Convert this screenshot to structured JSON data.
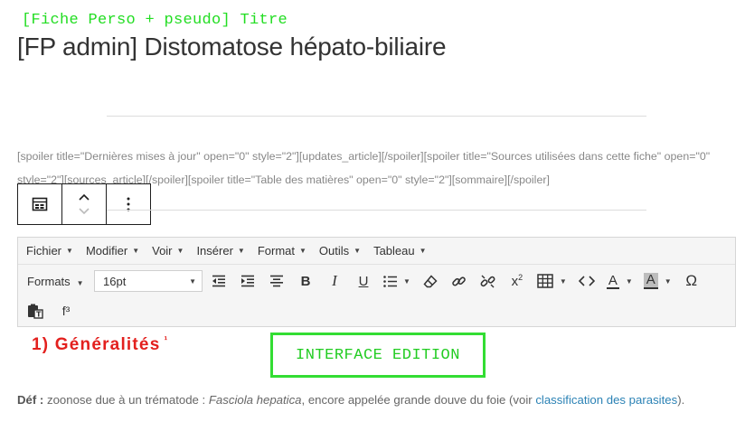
{
  "annotation_top": "[Fiche Perso + pseudo] Titre",
  "page_title": "[FP admin] Distomatose hépato-biliaire",
  "shortcode_text": "[spoiler title=\"Dernières mises à jour\" open=\"0\" style=\"2\"][updates_article][/spoiler][spoiler title=\"Sources utilisées dans cette fiche\" open=\"0\" style=\"2\"][sources_article][/spoiler][spoiler title=\"Table des matières\" open=\"0\" style=\"2\"][sommaire][/spoiler]",
  "block_toolbar": {
    "icons": [
      "block-type-icon",
      "move-up-down-icon",
      "more-options-icon"
    ]
  },
  "editor": {
    "menu": [
      "Fichier",
      "Modifier",
      "Voir",
      "Insérer",
      "Format",
      "Outils",
      "Tableau"
    ],
    "formats_label": "Formats",
    "font_size": "16pt",
    "superscript_label": "f³"
  },
  "section_heading": "1) Généralités",
  "section_heading_sup": "¹",
  "interface_label": "INTERFACE EDITION",
  "definition": {
    "label": "Déf :",
    "text1": " zoonose due à un trématode : ",
    "italic": "Fasciola hepatica",
    "text2": ", encore appelée grande douve du foie (voir ",
    "link": "classification des parasites",
    "text3": ")."
  },
  "colors": {
    "annotation_green": "#22dd22",
    "heading_red": "#e3201e",
    "link_blue": "#2b82b5"
  }
}
